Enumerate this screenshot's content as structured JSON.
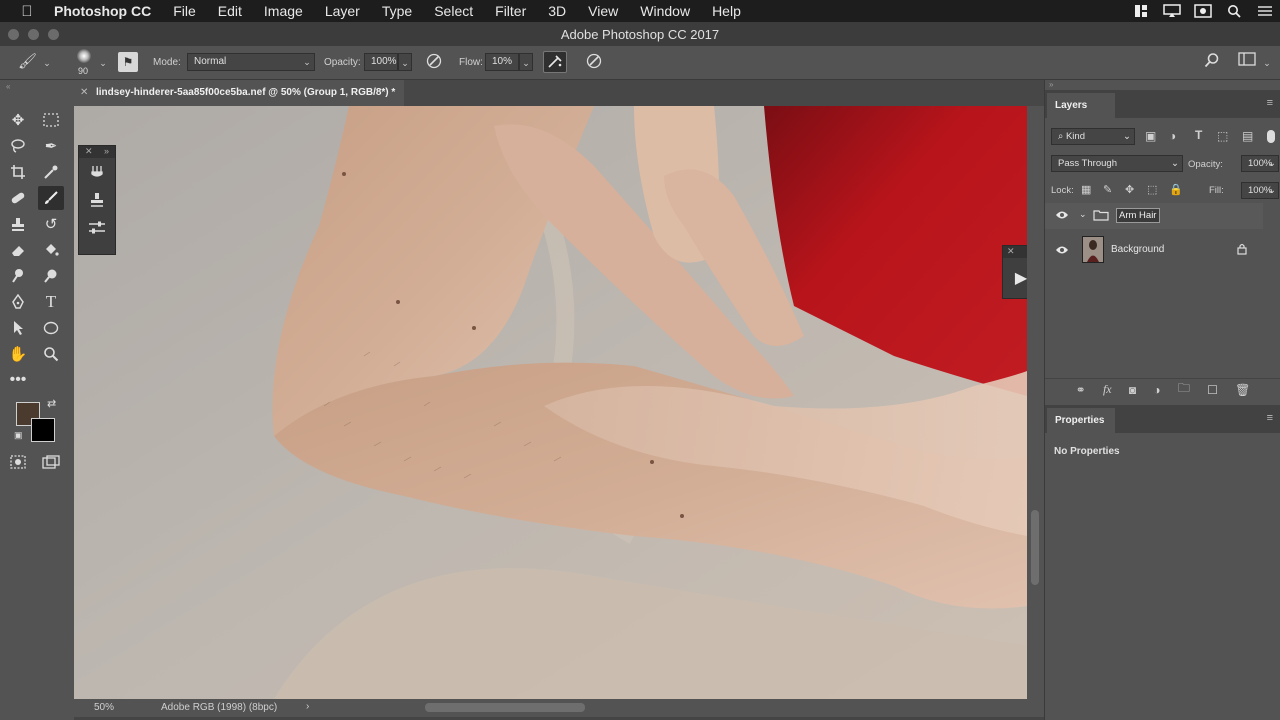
{
  "menubar": {
    "apple_icon": "apple-icon",
    "app_name": "Photoshop CC",
    "items": [
      "File",
      "Edit",
      "Image",
      "Layer",
      "Type",
      "Select",
      "Filter",
      "3D",
      "View",
      "Window",
      "Help"
    ],
    "status_icons": [
      "window-grid-icon",
      "airplay-icon",
      "record-icon",
      "search-icon",
      "list-icon"
    ]
  },
  "window": {
    "title": "Adobe Photoshop CC 2017"
  },
  "options": {
    "brush_size": "90",
    "mode_label": "Mode:",
    "mode_value": "Normal",
    "opacity_label": "Opacity:",
    "opacity_value": "100%",
    "flow_label": "Flow:",
    "flow_value": "10%"
  },
  "document": {
    "tab_title": "lindsey-hinderer-5aa85f00ce5ba.nef @ 50% (Group 1, RGB/8*) *",
    "zoom": "50%",
    "profile": "Adobe RGB (1998) (8bpc)"
  },
  "colors": {
    "foreground": "#4a3b2e",
    "background": "#000000",
    "accent_red": "#b8141b"
  },
  "layers_panel": {
    "title": "Layers",
    "filter_kind": "Kind",
    "blend_mode": "Pass Through",
    "opacity_label": "Opacity:",
    "opacity_value": "100%",
    "lock_label": "Lock:",
    "fill_label": "Fill:",
    "fill_value": "100%",
    "layers": [
      {
        "name": "Arm Hair",
        "type": "group",
        "editing": true
      },
      {
        "name": "Background",
        "type": "pixel",
        "locked": true
      }
    ]
  },
  "properties_panel": {
    "title": "Properties",
    "message": "No Properties"
  }
}
